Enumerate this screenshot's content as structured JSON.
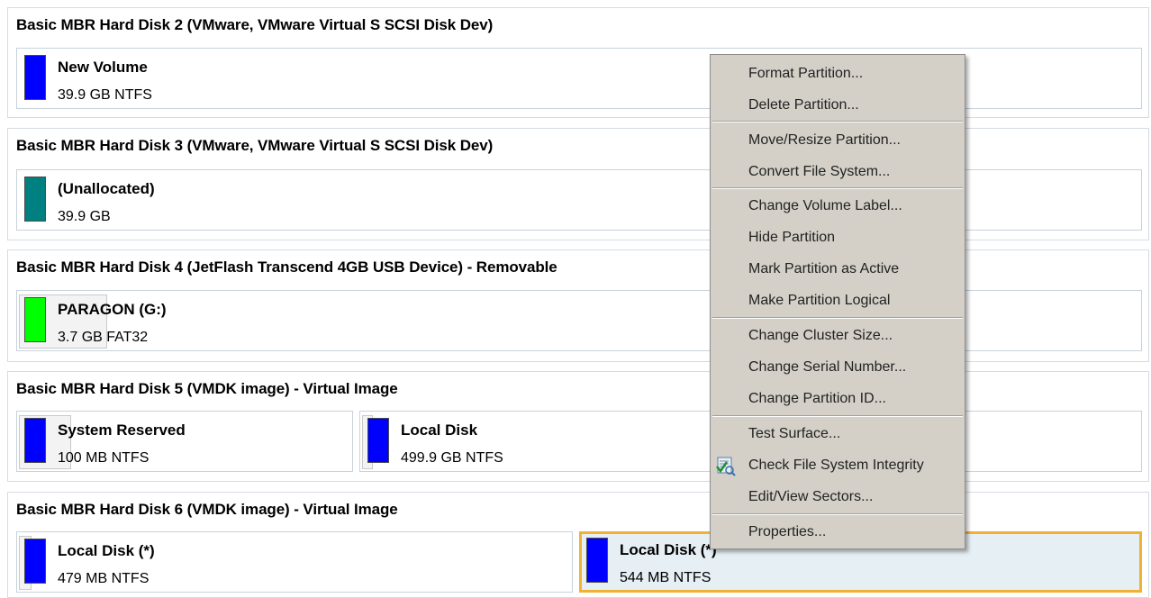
{
  "disks": [
    {
      "title": "Basic MBR Hard Disk 2 (VMware, VMware Virtual S SCSI Disk Dev)",
      "partitions": [
        {
          "name": "New Volume",
          "info": "39.9 GB NTFS",
          "color": "#0000ff"
        }
      ]
    },
    {
      "title": "Basic MBR Hard Disk 3 (VMware, VMware Virtual S SCSI Disk Dev)",
      "partitions": [
        {
          "name": "(Unallocated)",
          "info": "39.9 GB",
          "color": "#008080"
        }
      ]
    },
    {
      "title": "Basic MBR Hard Disk 4 (JetFlash Transcend 4GB USB Device) - Removable",
      "partitions": [
        {
          "name": "PARAGON (G:)",
          "info": "3.7 GB FAT32",
          "color": "#00ff00"
        }
      ]
    },
    {
      "title": "Basic MBR Hard Disk 5 (VMDK image) - Virtual Image",
      "partitions": [
        {
          "name": "System Reserved",
          "info": "100 MB NTFS",
          "color": "#0000ff"
        },
        {
          "name": "Local Disk",
          "info": "499.9 GB NTFS",
          "color": "#0000ff"
        }
      ]
    },
    {
      "title": "Basic MBR Hard Disk 6 (VMDK image) - Virtual Image",
      "partitions": [
        {
          "name": "Local Disk (*)",
          "info": "479 MB NTFS",
          "color": "#0000ff"
        },
        {
          "name": "Local Disk (*)",
          "info": "544 MB NTFS",
          "color": "#0000ff",
          "selected": true
        }
      ]
    }
  ],
  "context_menu": {
    "items": [
      "Format Partition...",
      "Delete Partition...",
      "Move/Resize Partition...",
      "Convert File System...",
      "Change Volume Label...",
      "Hide Partition",
      "Mark Partition as Active",
      "Make Partition Logical",
      "Change Cluster Size...",
      "Change Serial Number...",
      "Change Partition ID...",
      "Test Surface...",
      "Check File System Integrity",
      "Edit/View Sectors...",
      "Properties..."
    ],
    "check_icon": "check-integrity-icon"
  },
  "colors": {
    "selection_border": "#f0b232",
    "menu_background": "#d4d0c8"
  }
}
